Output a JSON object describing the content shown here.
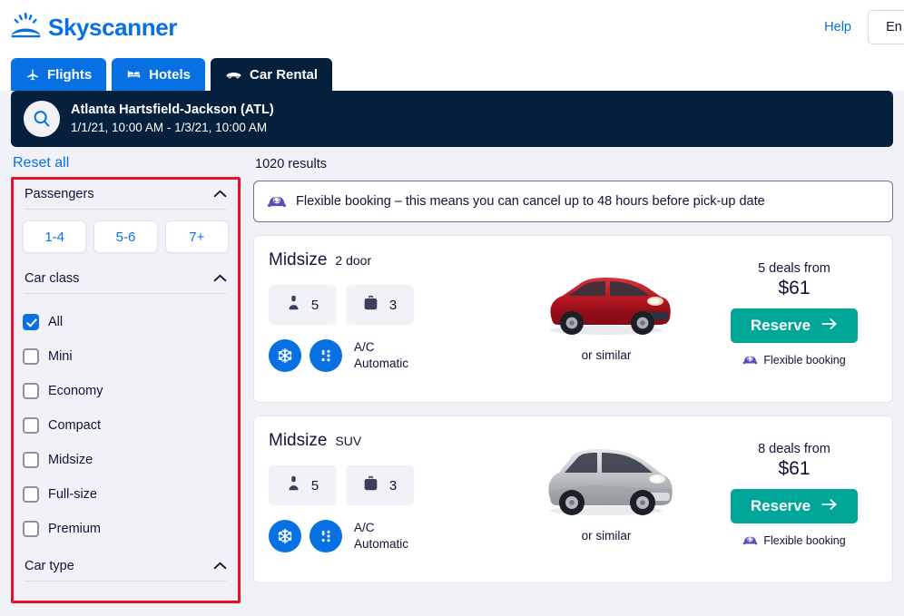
{
  "header": {
    "brand": "Skyscanner",
    "brand_icon": "sunrise-logo-icon",
    "brand_color": "#0770e3",
    "help_label": "Help",
    "language_label": "En"
  },
  "tabs": [
    {
      "label": "Flights",
      "icon": "plane-icon",
      "active": false
    },
    {
      "label": "Hotels",
      "icon": "bed-icon",
      "active": false
    },
    {
      "label": "Car Rental",
      "icon": "car-icon",
      "active": true
    }
  ],
  "search_summary": {
    "icon": "search-magnifier-icon",
    "location": "Atlanta Hartsfield-Jackson (ATL)",
    "dates": "1/1/21, 10:00 AM - 1/3/21, 10:00 AM",
    "background_color": "#05203c"
  },
  "sidebar": {
    "reset_label": "Reset all",
    "highlight_color": "#e8112d",
    "passengers": {
      "title": "Passengers",
      "collapse_icon": "chevron-up-icon",
      "options": [
        "1-4",
        "5-6",
        "7+"
      ]
    },
    "car_class": {
      "title": "Car class",
      "collapse_icon": "chevron-up-icon",
      "options": [
        {
          "label": "All",
          "checked": true
        },
        {
          "label": "Mini",
          "checked": false
        },
        {
          "label": "Economy",
          "checked": false
        },
        {
          "label": "Compact",
          "checked": false
        },
        {
          "label": "Midsize",
          "checked": false
        },
        {
          "label": "Full-size",
          "checked": false
        },
        {
          "label": "Premium",
          "checked": false
        }
      ]
    },
    "car_type": {
      "title": "Car type",
      "collapse_icon": "chevron-up-icon"
    }
  },
  "results": {
    "count_label": "1020 results",
    "flexible_banner": {
      "icon": "flexible-booking-car-icon",
      "text": "Flexible booking – this means you can cancel up to 48 hours before pick-up date",
      "icon_color": "#5f4bb6"
    },
    "cards": [
      {
        "title": "Midsize",
        "subtitle": "2 door",
        "seats": "5",
        "bags": "3",
        "seats_icon": "passenger-icon",
        "bags_icon": "suitcase-icon",
        "ac_icon": "snowflake-icon",
        "transmission_icon": "gearshift-icon",
        "feature_line1": "A/C",
        "feature_line2": "Automatic",
        "car_image": "red-sedan-image",
        "car_color": "#b5121b",
        "or_similar": "or similar",
        "deals_label": "5 deals from",
        "price": "$61",
        "reserve_label": "Reserve",
        "reserve_icon": "arrow-right-icon",
        "flexible_label": "Flexible booking"
      },
      {
        "title": "Midsize",
        "subtitle": "SUV",
        "seats": "5",
        "bags": "3",
        "seats_icon": "passenger-icon",
        "bags_icon": "suitcase-icon",
        "ac_icon": "snowflake-icon",
        "transmission_icon": "gearshift-icon",
        "feature_line1": "A/C",
        "feature_line2": "Automatic",
        "car_image": "silver-suv-image",
        "car_color": "#b9bcc0",
        "or_similar": "or similar",
        "deals_label": "8 deals from",
        "price": "$61",
        "reserve_label": "Reserve",
        "reserve_icon": "arrow-right-icon",
        "flexible_label": "Flexible booking"
      }
    ]
  }
}
